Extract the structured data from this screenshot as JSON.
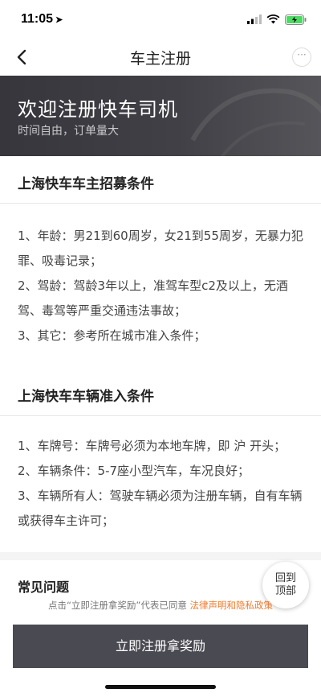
{
  "status": {
    "time": "11:05",
    "location_glyph": "➤"
  },
  "nav": {
    "title": "车主注册",
    "more": "···"
  },
  "hero": {
    "title": "欢迎注册快车司机",
    "subtitle": "时间自由，订单量大"
  },
  "sections": [
    {
      "heading": "上海快车车主招募条件",
      "items": [
        "1、年龄：男21到60周岁，女21到55周岁，无暴力犯罪、吸毒记录；",
        "2、驾龄：驾龄3年以上，准驾车型c2及以上，无酒驾、毒驾等严重交通违法事故；",
        "3、其它：参考所在城市准入条件；"
      ]
    },
    {
      "heading": "上海快车车辆准入条件",
      "items": [
        "1、车牌号：车牌号必须为本地车牌，即 沪 开头；",
        "2、车辆条件：5-7座小型汽车，车况良好；",
        "3、车辆所有人：驾驶车辆必须为注册车辆，自有车辆或获得车主许可；"
      ]
    }
  ],
  "faq": {
    "title": "常见问题"
  },
  "agreement": {
    "prefix": "点击“立即注册拿奖励”代表已同意 ",
    "link": "法律声明和隐私政策"
  },
  "back_to_top": "回到顶部",
  "cta": "立即注册拿奖励"
}
